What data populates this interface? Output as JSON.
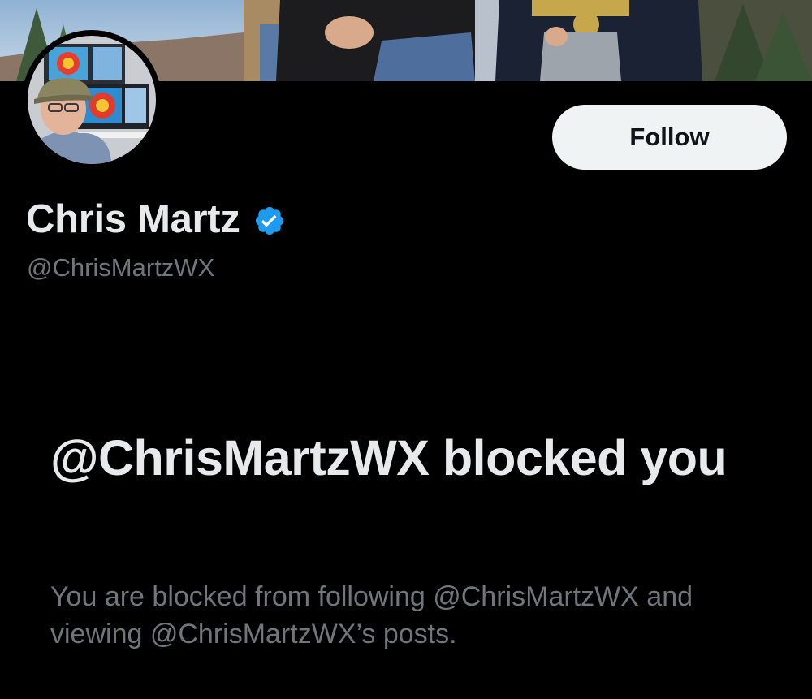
{
  "profile": {
    "display_name": "Chris Martz",
    "handle": "@ChrisMartzWX",
    "verified": true,
    "verified_icon": "verified-badge-icon"
  },
  "actions": {
    "follow_label": "Follow"
  },
  "blocked_notice": {
    "title": "@ChrisMartzWX blocked you",
    "description": "You are blocked from following @ChrisMartzWX and viewing @ChrisMartzWX’s posts."
  },
  "colors": {
    "background": "#000000",
    "primary_text": "#e7e9ea",
    "secondary_text": "#71767b",
    "follow_button_bg": "#eff3f4",
    "verified_blue": "#1d9bf0"
  }
}
